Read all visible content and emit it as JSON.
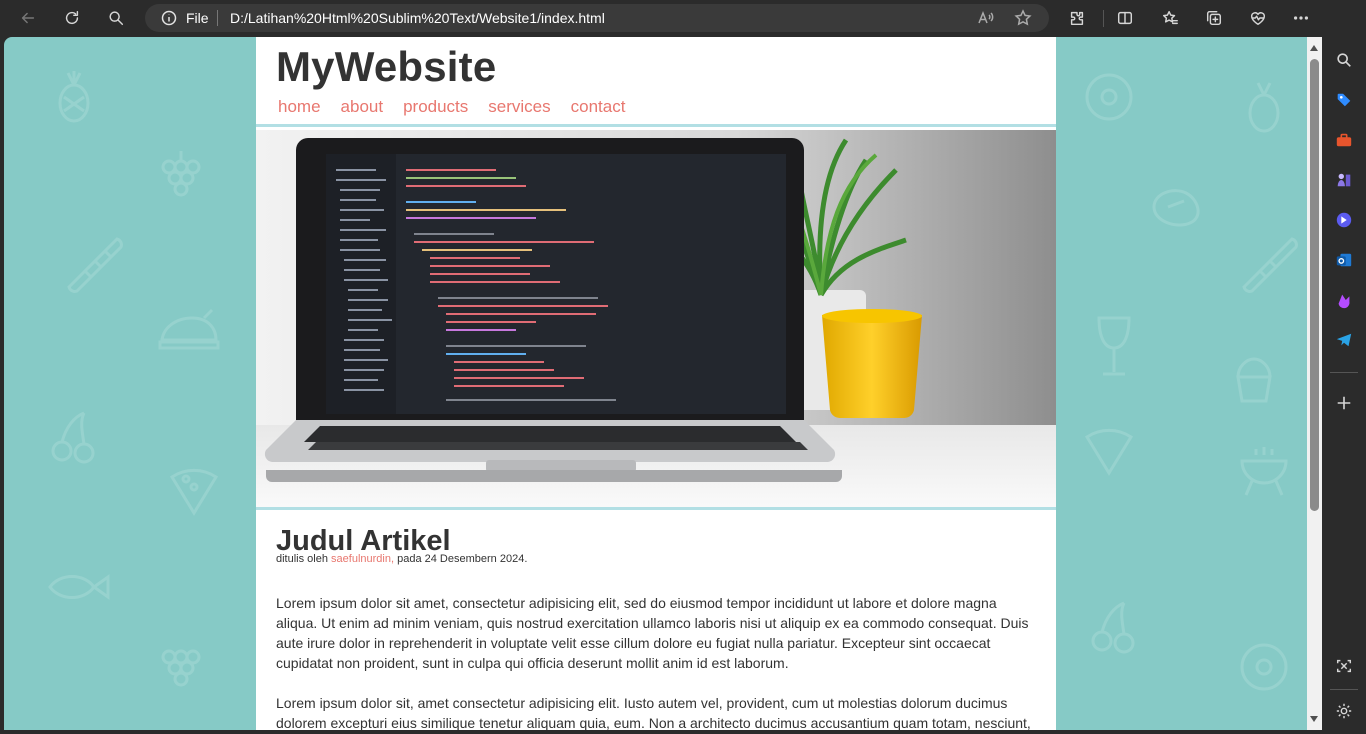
{
  "browser": {
    "scheme_label": "File",
    "url": "D:/Latihan%20Html%20Sublim%20Text/Website1/index.html",
    "toolbar_icons": [
      "back-icon",
      "refresh-icon",
      "search-icon",
      "info-icon",
      "read-aloud-icon",
      "favorite-star-icon",
      "extensions-icon",
      "split-screen-icon",
      "favorites-icon",
      "collections-icon",
      "browser-essentials-icon",
      "more-icon",
      "copilot-icon"
    ],
    "sidebar_icons": [
      "search-icon",
      "shopping-tag-icon",
      "tools-icon",
      "games-icon",
      "copilot-icon",
      "outlook-icon",
      "drop-icon",
      "telegram-icon",
      "add-icon",
      "screenshot-icon",
      "settings-icon"
    ]
  },
  "site": {
    "title": "MyWebsite",
    "nav": [
      "home",
      "about",
      "products",
      "services",
      "contact"
    ],
    "accent_color": "#e8776f",
    "background_color": "#86cac6"
  },
  "article": {
    "heading": "Judul Artikel",
    "meta_prefix": "ditulis oleh",
    "author": "saefulnurdin,",
    "meta_suffix": "pada 24 Desembern 2024.",
    "paragraphs": [
      "Lorem ipsum dolor sit amet, consectetur adipisicing elit, sed do eiusmod tempor incididunt ut labore et dolore magna aliqua. Ut enim ad minim veniam, quis nostrud exercitation ullamco laboris nisi ut aliquip ex ea commodo consequat. Duis aute irure dolor in reprehenderit in voluptate velit esse cillum dolore eu fugiat nulla pariatur. Excepteur sint occaecat cupidatat non proident, sunt in culpa qui officia deserunt mollit anim id est laborum.",
      "Lorem ipsum dolor sit, amet consectetur adipisicing elit. Iusto autem vel, provident, cum ut molestias dolorum ducimus dolorem excepturi eius similique tenetur aliquam quia, eum. Non a architecto ducimus accusantium quam totam, nesciunt,"
    ]
  }
}
